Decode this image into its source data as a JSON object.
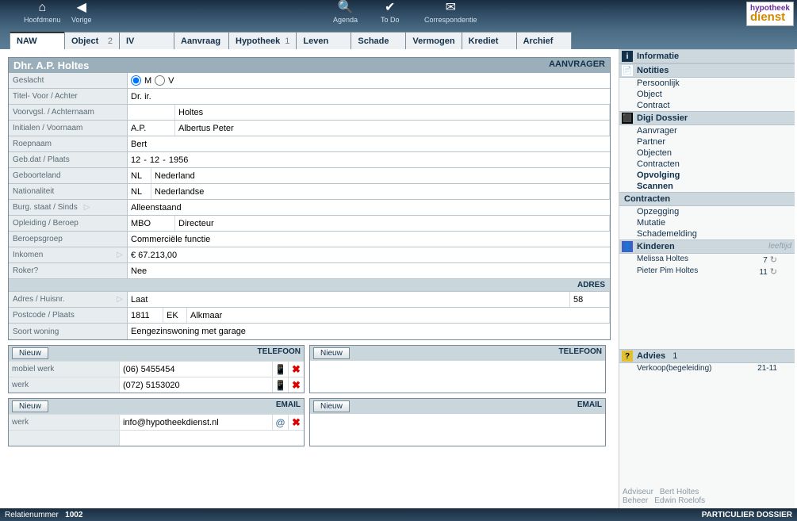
{
  "topbar": {
    "home": "Hoofdmenu",
    "prev": "Vorige",
    "agenda": "Agenda",
    "todo": "To Do",
    "corresp": "Correspondentie"
  },
  "logo": {
    "top": "hypotheek",
    "bot": "dienst"
  },
  "tabs": [
    {
      "label": "NAW",
      "badge": ""
    },
    {
      "label": "Object",
      "badge": "2"
    },
    {
      "label": "IV",
      "badge": ""
    },
    {
      "label": "Aanvraag",
      "badge": ""
    },
    {
      "label": "Hypotheek",
      "badge": "1"
    },
    {
      "label": "Leven",
      "badge": ""
    },
    {
      "label": "Schade",
      "badge": ""
    },
    {
      "label": "Vermogen",
      "badge": ""
    },
    {
      "label": "Krediet",
      "badge": ""
    },
    {
      "label": "Archief",
      "badge": ""
    }
  ],
  "panel": {
    "title": "Dhr. A.P. Holtes",
    "type": "AANVRAGER"
  },
  "labels": {
    "geslacht": "Geslacht",
    "titel": "Titel- Voor / Achter",
    "voorvgsl": "Voorvgsl. / Achternaam",
    "initialen": "Initialen / Voornaam",
    "roepnaam": "Roepnaam",
    "gebdat": "Geb.dat / Plaats",
    "geboorteland": "Geboorteland",
    "nationaliteit": "Nationaliteit",
    "burg": "Burg. staat / Sinds",
    "opleiding": "Opleiding / Beroep",
    "beroepsgroep": "Beroepsgroep",
    "inkomen": "Inkomen",
    "roker": "Roker?",
    "adres_sec": "ADRES",
    "adres": "Adres / Huisnr.",
    "postcode": "Postcode / Plaats",
    "soortwoning": "Soort woning",
    "telefoon": "TELEFOON",
    "email": "EMAIL",
    "nieuw": "Nieuw"
  },
  "values": {
    "m": "M",
    "v": "V",
    "titel": "Dr. ir.",
    "achternaam": "Holtes",
    "initialen": "A.P.",
    "voornaam": "Albertus Peter",
    "roepnaam": "Bert",
    "geb_d": "12",
    "geb_m": "12",
    "geb_y": "1956",
    "geb_land_code": "NL",
    "geb_land": "Nederland",
    "nat_code": "NL",
    "nat": "Nederlandse",
    "burg": "Alleenstaand",
    "opleiding": "MBO",
    "beroep": "Directeur",
    "beroepsgroep": "Commerciële functie",
    "inkomen": "€ 67.213,00",
    "roker": "Nee",
    "adres": "Laat",
    "huisnr": "58",
    "pc1": "1811",
    "pc2": "EK",
    "plaats": "Alkmaar",
    "soortwoning": "Eengezinswoning met garage",
    "tel1_lbl": "mobiel werk",
    "tel1_val": "(06) 5455454",
    "tel2_lbl": "werk",
    "tel2_val": "(072) 5153020",
    "email1_lbl": "werk",
    "email1_val": "info@hypotheekdienst.nl"
  },
  "right": {
    "informatie": "Informatie",
    "notities": "Notities",
    "notities_items": [
      "Persoonlijk",
      "Object",
      "Contract"
    ],
    "digi": "Digi Dossier",
    "digi_items": [
      "Aanvrager",
      "Partner",
      "Objecten",
      "Contracten"
    ],
    "opvolging": "Opvolging",
    "scannen": "Scannen",
    "contracten": "Contracten",
    "contracten_items": [
      "Opzegging",
      "Mutatie",
      "Schademelding"
    ],
    "kinderen": "Kinderen",
    "leeftijd": "leeftijd",
    "kid1_name": "Melissa Holtes",
    "kid1_age": "7",
    "kid2_name": "Pieter Pim Holtes",
    "kid2_age": "11",
    "advies": "Advies",
    "advies_count": "1",
    "advies_row": "Verkoop(begeleiding)",
    "advies_date": "21-11",
    "adviseur_lbl": "Adviseur",
    "adviseur": "Bert Holtes",
    "beheer_lbl": "Beheer",
    "beheer": "Edwin Roelofs"
  },
  "status": {
    "relnr_lbl": "Relatienummer",
    "relnr": "1002",
    "dossier": "PARTICULIER DOSSIER"
  }
}
